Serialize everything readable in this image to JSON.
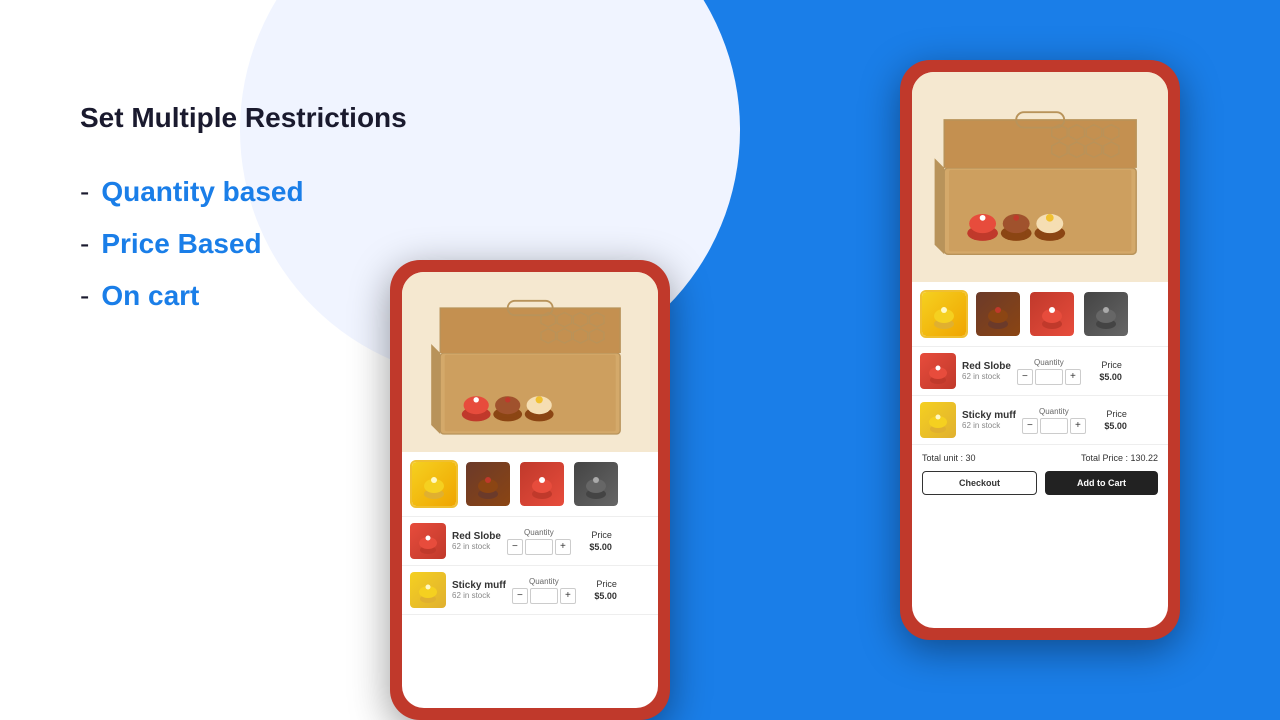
{
  "background": {
    "left_color": "#ffffff",
    "right_color": "#1a7ee8"
  },
  "left_panel": {
    "title": "Set Multiple Restrictions",
    "features": [
      {
        "id": "quantity",
        "dash": "-",
        "label": "Quantity based"
      },
      {
        "id": "price",
        "dash": "-",
        "label": "Price Based"
      },
      {
        "id": "cart",
        "dash": "-",
        "label": "On cart"
      }
    ]
  },
  "phone_small": {
    "products": [
      {
        "name": "Red Slobe",
        "stock": "62 in stock",
        "price_label": "Price",
        "price_value": "$5.00",
        "qty_label": "Quantity"
      },
      {
        "name": "Sticky muff",
        "stock": "62 in stock",
        "price_label": "Price",
        "price_value": "$5.00",
        "qty_label": "Quantity"
      }
    ]
  },
  "phone_large": {
    "products": [
      {
        "name": "Red Slobe",
        "stock": "62 in stock",
        "price_label": "Price",
        "price_value": "$5.00",
        "qty_label": "Quantity"
      },
      {
        "name": "Sticky muff",
        "stock": "62 in stock",
        "price_label": "Price",
        "price_value": "$5.00",
        "qty_label": "Quantity"
      }
    ],
    "total_unit_label": "Total unit : 30",
    "total_price_label": "Total Price : 130.22",
    "btn_checkout": "Checkout",
    "btn_addcart": "Add to Cart"
  }
}
